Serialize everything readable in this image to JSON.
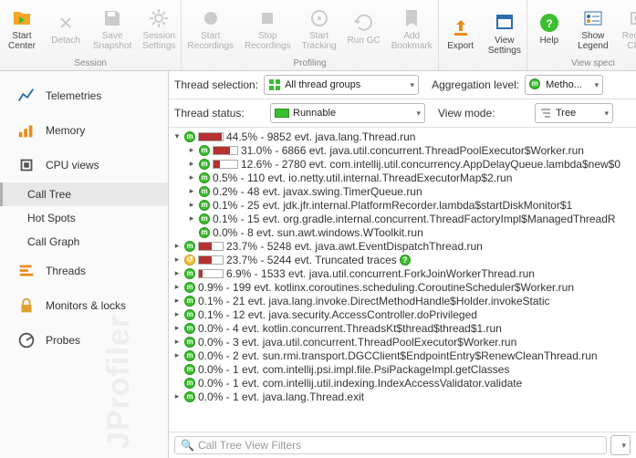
{
  "toolbar": {
    "groups": [
      {
        "label": "Session",
        "buttons": [
          {
            "label": "Start\nCenter",
            "icon": "folder-play",
            "enabled": true,
            "color": "#f5a623"
          },
          {
            "label": "Detach",
            "icon": "disconnect",
            "enabled": false
          },
          {
            "label": "Save\nSnapshot",
            "icon": "save",
            "enabled": false
          },
          {
            "label": "Session\nSettings",
            "icon": "gear",
            "enabled": false
          }
        ]
      },
      {
        "label": "Profiling",
        "buttons": [
          {
            "label": "Start\nRecordings",
            "icon": "rec",
            "enabled": false
          },
          {
            "label": "Stop\nRecordings",
            "icon": "stop",
            "enabled": false
          },
          {
            "label": "Start\nTracking",
            "icon": "track",
            "enabled": false
          },
          {
            "label": "Run GC",
            "icon": "gc",
            "enabled": false
          },
          {
            "label": "Add\nBookmark",
            "icon": "bookmark",
            "enabled": false
          }
        ]
      },
      {
        "label": "",
        "buttons": [
          {
            "label": "Export",
            "icon": "export",
            "enabled": true,
            "color": "#e88c1a"
          },
          {
            "label": "View\nSettings",
            "icon": "vsettings",
            "enabled": true,
            "color": "#2a6db0"
          }
        ]
      },
      {
        "label": "View speci",
        "buttons": [
          {
            "label": "Help",
            "icon": "help",
            "enabled": true,
            "color": "#3bbf2e"
          },
          {
            "label": "Show\nLegend",
            "icon": "legend",
            "enabled": true,
            "color": "#2a6db0"
          },
          {
            "label": "Record\nCPU",
            "icon": "reccpu",
            "enabled": false
          }
        ]
      }
    ]
  },
  "sidebar": {
    "items": [
      {
        "label": "Telemetries",
        "icon": "telemetry",
        "color": "#2a6db0"
      },
      {
        "label": "Memory",
        "icon": "memory",
        "color": "#e88c1a"
      },
      {
        "label": "CPU views",
        "icon": "cpu",
        "color": "#555"
      },
      {
        "label": "Call Tree",
        "icon": "",
        "sub": true,
        "selected": true
      },
      {
        "label": "Hot Spots",
        "icon": "",
        "sub": true
      },
      {
        "label": "Call Graph",
        "icon": "",
        "sub": true
      },
      {
        "label": "Threads",
        "icon": "threads",
        "color": "#e88c1a"
      },
      {
        "label": "Monitors & locks",
        "icon": "lock",
        "color": "#e0a030"
      },
      {
        "label": "Probes",
        "icon": "probe",
        "color": "#555"
      }
    ],
    "watermark": "JProfiler"
  },
  "options": {
    "thread_selection_label": "Thread selection:",
    "thread_selection_value": "All thread groups",
    "aggregation_label": "Aggregation level:",
    "aggregation_value": "Metho...",
    "thread_status_label": "Thread status:",
    "thread_status_value": "Runnable",
    "view_mode_label": "View mode:",
    "view_mode_value": "Tree"
  },
  "tree": {
    "rows": [
      {
        "d": 0,
        "c": "v",
        "bar": 44.5,
        "txt": "44.5% - 9852 evt. java.lang.Thread.run"
      },
      {
        "d": 1,
        "c": ">",
        "bar": 31.0,
        "txt": "31.0% - 6866 evt. java.util.concurrent.ThreadPoolExecutor$Worker.run"
      },
      {
        "d": 1,
        "c": ">",
        "bar": 12.6,
        "txt": "12.6% - 2780 evt. com.intellij.util.concurrency.AppDelayQueue.lambda$new$0"
      },
      {
        "d": 1,
        "c": ">",
        "txt": "0.5% - 110 evt. io.netty.util.internal.ThreadExecutorMap$2.run"
      },
      {
        "d": 1,
        "c": ">",
        "txt": "0.2% - 48 evt. javax.swing.TimerQueue.run"
      },
      {
        "d": 1,
        "c": ">",
        "txt": "0.1% - 25 evt. jdk.jfr.internal.PlatformRecorder.lambda$startDiskMonitor$1"
      },
      {
        "d": 1,
        "c": ">",
        "txt": "0.1% - 15 evt. org.gradle.internal.concurrent.ThreadFactoryImpl$ManagedThreadR"
      },
      {
        "d": 1,
        "c": "",
        "txt": "0.0% - 8 evt. sun.awt.windows.WToolkit.run"
      },
      {
        "d": 0,
        "c": ">",
        "bar": 23.7,
        "txt": "23.7% - 5248 evt. java.awt.EventDispatchThread.run"
      },
      {
        "d": 0,
        "c": ">",
        "y": true,
        "bar": 23.7,
        "txt": "23.7% - 5244 evt. Truncated traces",
        "help": true
      },
      {
        "d": 0,
        "c": ">",
        "bar": 6.9,
        "txt": "6.9% - 1533 evt. java.util.concurrent.ForkJoinWorkerThread.run"
      },
      {
        "d": 0,
        "c": ">",
        "txt": "0.9% - 199 evt. kotlinx.coroutines.scheduling.CoroutineScheduler$Worker.run"
      },
      {
        "d": 0,
        "c": ">",
        "txt": "0.1% - 21 evt. java.lang.invoke.DirectMethodHandle$Holder.invokeStatic"
      },
      {
        "d": 0,
        "c": ">",
        "txt": "0.1% - 12 evt. java.security.AccessController.doPrivileged"
      },
      {
        "d": 0,
        "c": ">",
        "txt": "0.0% - 4 evt. kotlin.concurrent.ThreadsKt$thread$thread$1.run"
      },
      {
        "d": 0,
        "c": ">",
        "txt": "0.0% - 3 evt. java.util.concurrent.ThreadPoolExecutor$Worker.run"
      },
      {
        "d": 0,
        "c": ">",
        "txt": "0.0% - 2 evt. sun.rmi.transport.DGCClient$EndpointEntry$RenewCleanThread.run"
      },
      {
        "d": 0,
        "c": "",
        "txt": "0.0% - 1 evt. com.intellij.psi.impl.file.PsiPackageImpl.getClasses"
      },
      {
        "d": 0,
        "c": "",
        "txt": "0.0% - 1 evt. com.intellij.util.indexing.IndexAccessValidator.validate"
      },
      {
        "d": 0,
        "c": ">",
        "txt": "0.0% - 1 evt. java.lang.Thread.exit"
      }
    ]
  },
  "filter": {
    "placeholder": "Call Tree View Filters"
  }
}
